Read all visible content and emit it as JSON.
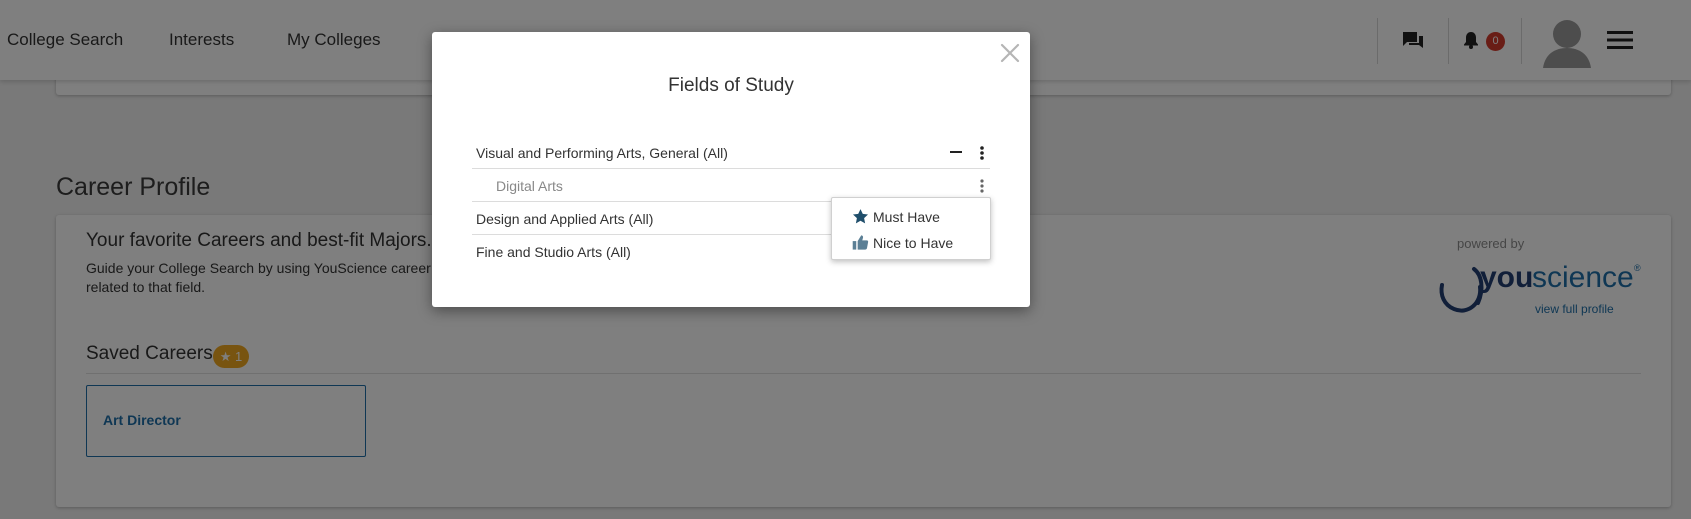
{
  "nav": {
    "links": [
      "College Search",
      "Interests",
      "My Colleges"
    ],
    "notification_count": "0"
  },
  "career_profile": {
    "section_title": "Career Profile",
    "heading": "Your favorite Careers and best-fit Majors.",
    "description_line1": "Guide your College Search by using YouScience career r",
    "description_line2": "related to that field.",
    "saved_careers_label": "Saved Careers",
    "saved_count_badge": "★ 1",
    "careers": [
      "Art Director"
    ],
    "powered_by": "powered by",
    "logo_text_you": "you",
    "logo_text_science": "science",
    "logo_registered": "®",
    "view_full_profile": "view full profile"
  },
  "modal": {
    "title": "Fields of Study",
    "rows": [
      {
        "label": "Visual and Performing Arts, General (All)",
        "indent": false
      },
      {
        "label": "Digital Arts",
        "indent": true
      },
      {
        "label": "Design and Applied Arts (All)",
        "indent": false
      },
      {
        "label": "Fine and Studio Arts (All)",
        "indent": false
      }
    ],
    "dropdown": {
      "must_have": "Must Have",
      "nice_to_have": "Nice to Have"
    }
  },
  "colors": {
    "accent_blue": "#1e6fa8",
    "badge_orange": "#f0a820",
    "notification_red": "#d33a2c",
    "icon_dark_teal": "#1f4e6b",
    "logo_navy": "#233f73"
  }
}
